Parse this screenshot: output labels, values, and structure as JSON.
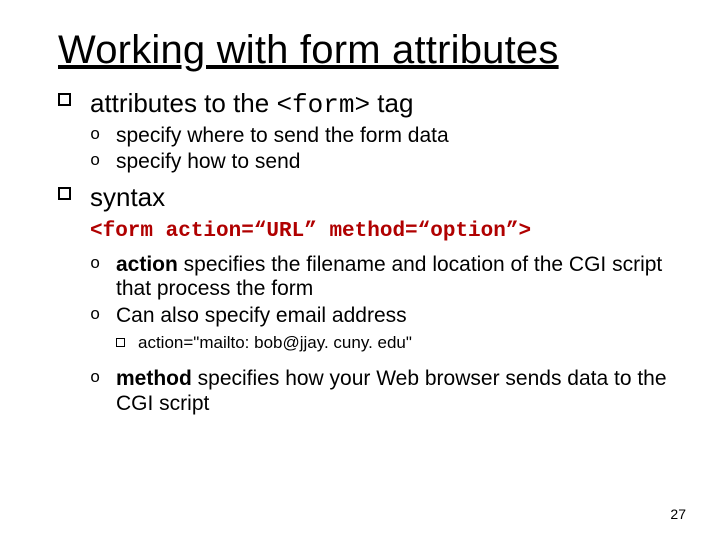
{
  "title": "Working with form attributes",
  "bullets": {
    "b1": {
      "prefix": "attributes to the ",
      "code": "<form>",
      "suffix": " tag",
      "sub": {
        "s1": "specify where to send the form data",
        "s2": "specify how to send"
      }
    },
    "b2": {
      "label": "syntax",
      "code": "<form action=“URL” method=“option”>",
      "sub": {
        "s1": {
          "bold": "action",
          "rest": " specifies the filename and location of the CGI script that process the form"
        },
        "s2": "Can also specify email address",
        "s2sub": {
          "t1": "action=\"mailto: bob@jjay. cuny. edu\""
        },
        "s3": {
          "bold": "method",
          "rest": " specifies how your Web browser sends data to the CGI script"
        }
      }
    }
  },
  "page_number": "27"
}
